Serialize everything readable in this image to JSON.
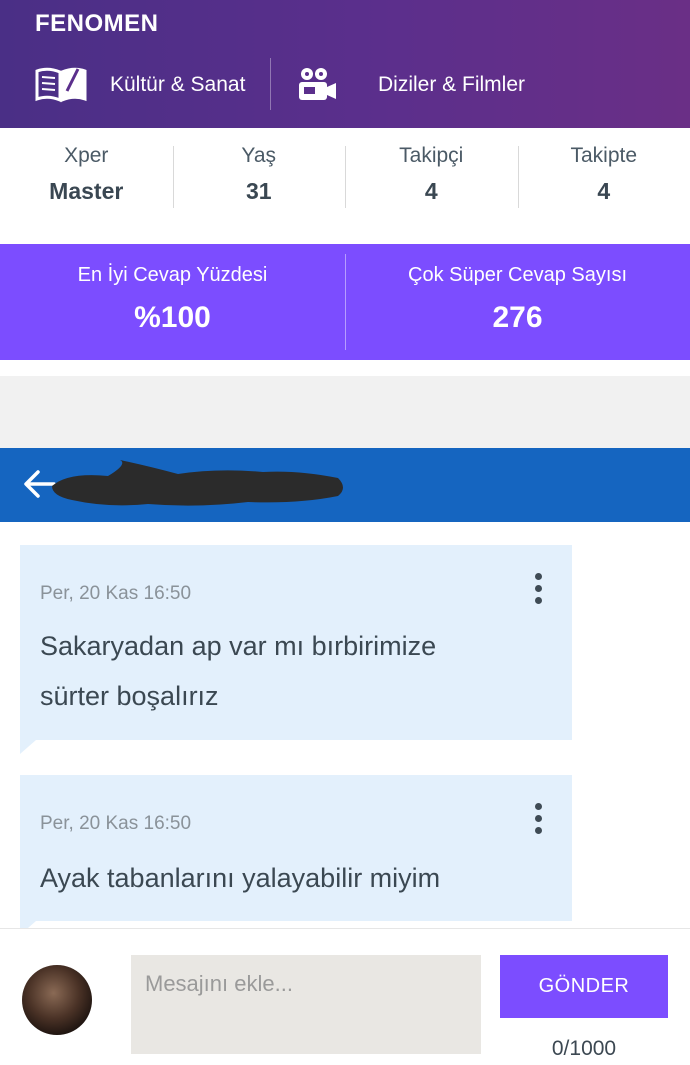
{
  "profile": {
    "badge": "FENOMEN",
    "categories": [
      {
        "icon": "book-icon",
        "label": "Kültür & Sanat"
      },
      {
        "icon": "film-camera-icon",
        "label": "Diziler & Filmler"
      }
    ]
  },
  "stats": [
    {
      "label": "Xper",
      "value": "Master"
    },
    {
      "label": "Yaş",
      "value": "31"
    },
    {
      "label": "Takipçi",
      "value": "4"
    },
    {
      "label": "Takipte",
      "value": "4"
    }
  ],
  "performance": [
    {
      "label": "En İyi Cevap Yüzdesi",
      "value": "%100"
    },
    {
      "label": "Çok Süper Cevap Sayısı",
      "value": "276"
    }
  ],
  "chat": {
    "back_icon": "arrow-left-icon",
    "title_redacted": true,
    "colors": {
      "bar": "#1565c0",
      "bubble": "#e3f0fc",
      "accent": "#7c4dff"
    },
    "messages": [
      {
        "date": "Per, 20 Kas 16:50",
        "text": "Sakaryadan ap var mı bırbirimize sürter boşalırız"
      },
      {
        "date": "Per, 20 Kas 16:50",
        "text": "Ayak tabanlarını yalayabilir miyim"
      }
    ]
  },
  "composer": {
    "placeholder": "Mesajını ekle...",
    "send_label": "GÖNDER",
    "counter": "0/1000"
  }
}
